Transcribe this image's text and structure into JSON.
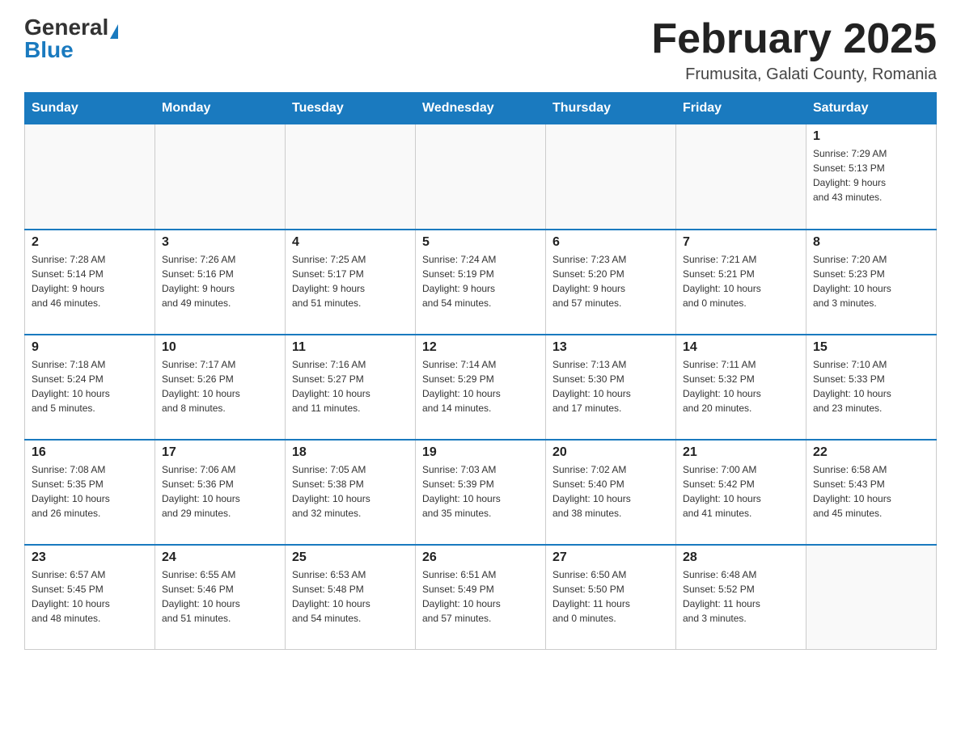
{
  "header": {
    "logo_general": "General",
    "logo_blue": "Blue",
    "month_title": "February 2025",
    "location": "Frumusita, Galati County, Romania"
  },
  "days_of_week": [
    "Sunday",
    "Monday",
    "Tuesday",
    "Wednesday",
    "Thursday",
    "Friday",
    "Saturday"
  ],
  "weeks": [
    [
      {
        "day": "",
        "info": ""
      },
      {
        "day": "",
        "info": ""
      },
      {
        "day": "",
        "info": ""
      },
      {
        "day": "",
        "info": ""
      },
      {
        "day": "",
        "info": ""
      },
      {
        "day": "",
        "info": ""
      },
      {
        "day": "1",
        "info": "Sunrise: 7:29 AM\nSunset: 5:13 PM\nDaylight: 9 hours\nand 43 minutes."
      }
    ],
    [
      {
        "day": "2",
        "info": "Sunrise: 7:28 AM\nSunset: 5:14 PM\nDaylight: 9 hours\nand 46 minutes."
      },
      {
        "day": "3",
        "info": "Sunrise: 7:26 AM\nSunset: 5:16 PM\nDaylight: 9 hours\nand 49 minutes."
      },
      {
        "day": "4",
        "info": "Sunrise: 7:25 AM\nSunset: 5:17 PM\nDaylight: 9 hours\nand 51 minutes."
      },
      {
        "day": "5",
        "info": "Sunrise: 7:24 AM\nSunset: 5:19 PM\nDaylight: 9 hours\nand 54 minutes."
      },
      {
        "day": "6",
        "info": "Sunrise: 7:23 AM\nSunset: 5:20 PM\nDaylight: 9 hours\nand 57 minutes."
      },
      {
        "day": "7",
        "info": "Sunrise: 7:21 AM\nSunset: 5:21 PM\nDaylight: 10 hours\nand 0 minutes."
      },
      {
        "day": "8",
        "info": "Sunrise: 7:20 AM\nSunset: 5:23 PM\nDaylight: 10 hours\nand 3 minutes."
      }
    ],
    [
      {
        "day": "9",
        "info": "Sunrise: 7:18 AM\nSunset: 5:24 PM\nDaylight: 10 hours\nand 5 minutes."
      },
      {
        "day": "10",
        "info": "Sunrise: 7:17 AM\nSunset: 5:26 PM\nDaylight: 10 hours\nand 8 minutes."
      },
      {
        "day": "11",
        "info": "Sunrise: 7:16 AM\nSunset: 5:27 PM\nDaylight: 10 hours\nand 11 minutes."
      },
      {
        "day": "12",
        "info": "Sunrise: 7:14 AM\nSunset: 5:29 PM\nDaylight: 10 hours\nand 14 minutes."
      },
      {
        "day": "13",
        "info": "Sunrise: 7:13 AM\nSunset: 5:30 PM\nDaylight: 10 hours\nand 17 minutes."
      },
      {
        "day": "14",
        "info": "Sunrise: 7:11 AM\nSunset: 5:32 PM\nDaylight: 10 hours\nand 20 minutes."
      },
      {
        "day": "15",
        "info": "Sunrise: 7:10 AM\nSunset: 5:33 PM\nDaylight: 10 hours\nand 23 minutes."
      }
    ],
    [
      {
        "day": "16",
        "info": "Sunrise: 7:08 AM\nSunset: 5:35 PM\nDaylight: 10 hours\nand 26 minutes."
      },
      {
        "day": "17",
        "info": "Sunrise: 7:06 AM\nSunset: 5:36 PM\nDaylight: 10 hours\nand 29 minutes."
      },
      {
        "day": "18",
        "info": "Sunrise: 7:05 AM\nSunset: 5:38 PM\nDaylight: 10 hours\nand 32 minutes."
      },
      {
        "day": "19",
        "info": "Sunrise: 7:03 AM\nSunset: 5:39 PM\nDaylight: 10 hours\nand 35 minutes."
      },
      {
        "day": "20",
        "info": "Sunrise: 7:02 AM\nSunset: 5:40 PM\nDaylight: 10 hours\nand 38 minutes."
      },
      {
        "day": "21",
        "info": "Sunrise: 7:00 AM\nSunset: 5:42 PM\nDaylight: 10 hours\nand 41 minutes."
      },
      {
        "day": "22",
        "info": "Sunrise: 6:58 AM\nSunset: 5:43 PM\nDaylight: 10 hours\nand 45 minutes."
      }
    ],
    [
      {
        "day": "23",
        "info": "Sunrise: 6:57 AM\nSunset: 5:45 PM\nDaylight: 10 hours\nand 48 minutes."
      },
      {
        "day": "24",
        "info": "Sunrise: 6:55 AM\nSunset: 5:46 PM\nDaylight: 10 hours\nand 51 minutes."
      },
      {
        "day": "25",
        "info": "Sunrise: 6:53 AM\nSunset: 5:48 PM\nDaylight: 10 hours\nand 54 minutes."
      },
      {
        "day": "26",
        "info": "Sunrise: 6:51 AM\nSunset: 5:49 PM\nDaylight: 10 hours\nand 57 minutes."
      },
      {
        "day": "27",
        "info": "Sunrise: 6:50 AM\nSunset: 5:50 PM\nDaylight: 11 hours\nand 0 minutes."
      },
      {
        "day": "28",
        "info": "Sunrise: 6:48 AM\nSunset: 5:52 PM\nDaylight: 11 hours\nand 3 minutes."
      },
      {
        "day": "",
        "info": ""
      }
    ]
  ]
}
